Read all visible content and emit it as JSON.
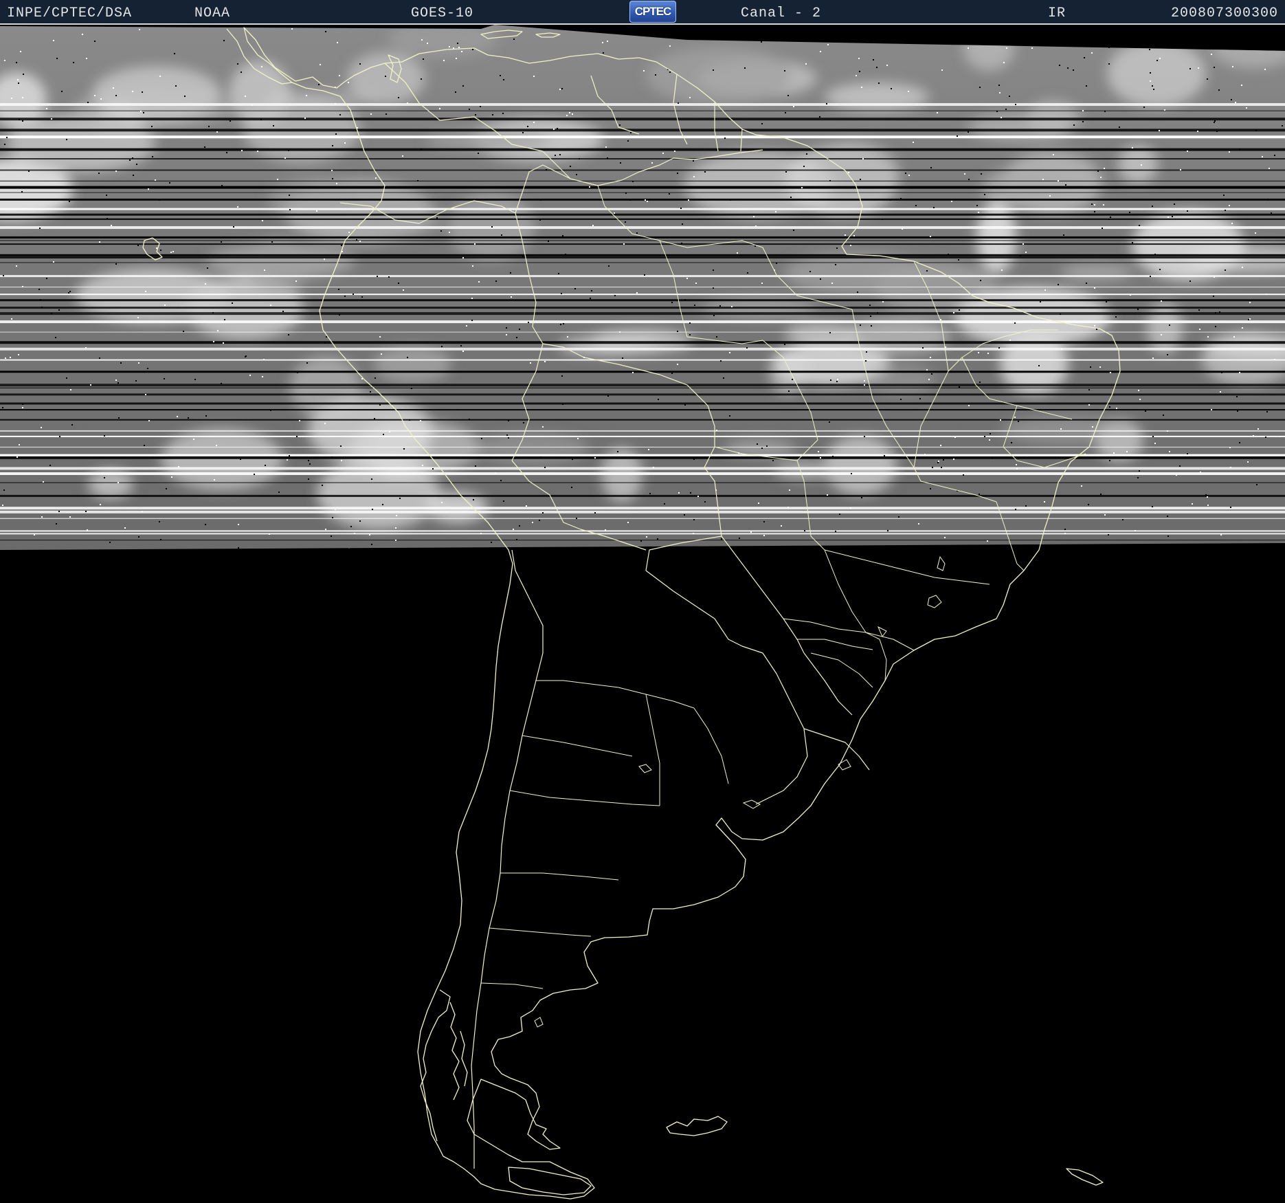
{
  "header": {
    "organization": "INPE/CPTEC/DSA",
    "agency": "NOAA",
    "satellite": "GOES-10",
    "logo_text": "CPTEC",
    "channel": "Canal - 2",
    "band": "IR",
    "timestamp": "200807300300"
  },
  "colors": {
    "background": "#000000",
    "header_bg": "#142233",
    "header_text": "#e6e6e6",
    "coastline": "#f2f2c8",
    "scanline_dark": "#000000",
    "scanline_bright": "#ffffff"
  },
  "map": {
    "region": "South America",
    "imagery": "Infrared satellite image with scan-line artifacts over the northern half",
    "overlays": [
      "coastlines",
      "country borders",
      "state borders"
    ]
  }
}
